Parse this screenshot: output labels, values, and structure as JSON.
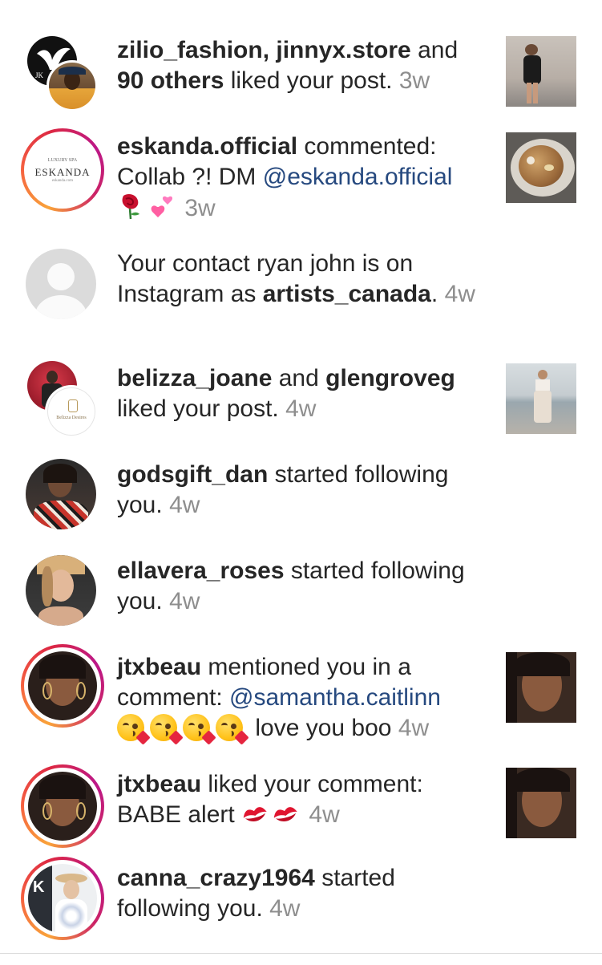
{
  "notifications": [
    {
      "avatar_icon": "bird-logo-and-person-avatar",
      "users": [
        "zilio_fashion",
        "jinnyx.store"
      ],
      "joiner": ", ",
      "and": " and",
      "others": "90 others",
      "action": " liked your post.",
      "time": "3w"
    },
    {
      "avatar_logo": "ESKANDA",
      "avatar_script_top": "LUXURY SPA",
      "avatar_script_bottom": "eskanda.com",
      "user": "eskanda.official",
      "action": " commented:",
      "line2": "Collab ?! DM ",
      "mention": "@eskanda.official",
      "emojis": [
        "rose-icon",
        "two-hearts-icon"
      ],
      "time": "3w"
    },
    {
      "avatar_icon": "default-person-icon",
      "line1": "Your contact ryan john is on",
      "line2_prefix": "Instagram as ",
      "user": "artists_canada",
      "period": ".",
      "time": "4w"
    },
    {
      "avatar_logo": "Belizza Desires",
      "user1": "belizza_joane",
      "and": " and ",
      "user2": "glengroveg",
      "action": "liked your post.",
      "time": "4w"
    },
    {
      "user": "godsgift_dan",
      "action": " started following",
      "action2": "you.",
      "time": "4w"
    },
    {
      "user": "ellavera_roses",
      "action": " started following",
      "action2": "you.",
      "time": "4w"
    },
    {
      "user": "jtxbeau",
      "action": " mentioned you in a",
      "line2": "comment: ",
      "mention": "@samantha.caitlinn",
      "emojis": [
        "kissing-face-icon",
        "kissing-face-icon",
        "kissing-face-icon",
        "kissing-face-icon"
      ],
      "text_after": "love you boo",
      "time": "4w"
    },
    {
      "user": "jtxbeau",
      "action": " liked your comment:",
      "line2": "BABE alert",
      "emojis": [
        "kiss-mark-icon",
        "kiss-mark-icon"
      ],
      "time": "4w"
    },
    {
      "user": "canna_crazy1964",
      "action": " started",
      "action2": "following you.",
      "time": "4w"
    }
  ],
  "colors": {
    "text": "#262626",
    "timestamp": "#8e8e8e",
    "mention": "#26497f",
    "story_ring": "#dc2743"
  }
}
